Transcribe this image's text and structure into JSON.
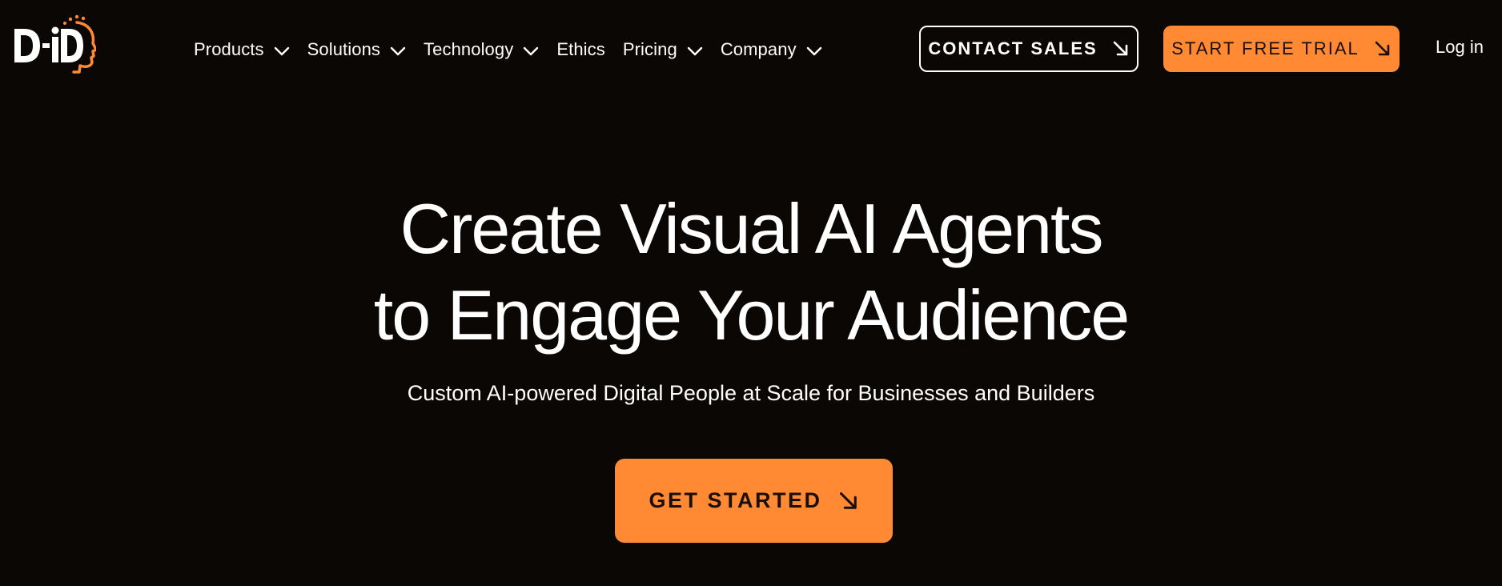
{
  "brand": {
    "logo_text": "D-iD",
    "colors": {
      "background": "#0a0705",
      "accent": "#ff8a33",
      "text": "#ffffff",
      "button_text_dark": "#1a0f07"
    }
  },
  "nav": {
    "items": [
      {
        "label": "Products",
        "has_dropdown": true,
        "icon": "chevron-down-icon"
      },
      {
        "label": "Solutions",
        "has_dropdown": true,
        "icon": "chevron-down-icon"
      },
      {
        "label": "Technology",
        "has_dropdown": true,
        "icon": "chevron-down-icon"
      },
      {
        "label": "Ethics",
        "has_dropdown": false
      },
      {
        "label": "Pricing",
        "has_dropdown": true,
        "icon": "chevron-down-icon"
      },
      {
        "label": "Company",
        "has_dropdown": true,
        "icon": "chevron-down-icon"
      }
    ]
  },
  "header_actions": {
    "contact_sales": {
      "label": "CONTACT SALES",
      "icon": "arrow-down-right-icon"
    },
    "start_trial": {
      "label": "START FREE TRIAL",
      "icon": "arrow-down-right-icon"
    },
    "login": {
      "label": "Log in"
    }
  },
  "hero": {
    "title_line1": "Create Visual AI Agents",
    "title_line2": "to Engage Your Audience",
    "subtitle": "Custom AI-powered Digital People at Scale for Businesses and Builders",
    "cta": {
      "label": "GET STARTED",
      "icon": "arrow-down-right-icon"
    }
  }
}
